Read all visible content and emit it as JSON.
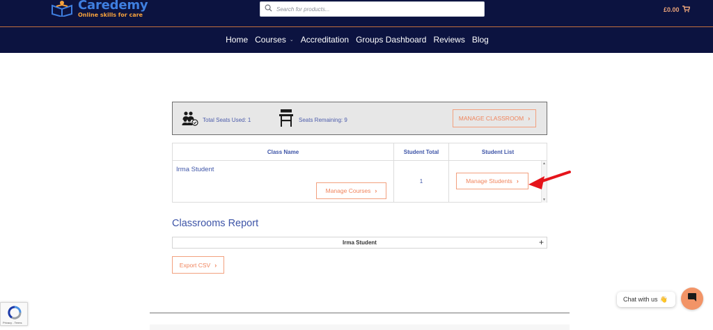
{
  "header": {
    "brand": "Caredemy",
    "tagline": "Online skills for care",
    "search_placeholder": "Search for products...",
    "cart_total": "£0.00"
  },
  "nav": {
    "items": [
      "Home",
      "Courses",
      "Accreditation",
      "Groups Dashboard",
      "Reviews",
      "Blog"
    ]
  },
  "seats": {
    "used_label": "Total Seats Used: 1",
    "remaining_label": "Seats Remaining: 9",
    "manage_classroom": "MANAGE CLASSROOM"
  },
  "class_table": {
    "headers": [
      "Class Name",
      "Student Total",
      "Student List"
    ],
    "rows": [
      {
        "class_name": "Irma Student",
        "student_total": "1",
        "manage_courses": "Manage Courses",
        "manage_students": "Manage Students"
      }
    ]
  },
  "report": {
    "title": "Classrooms Report",
    "accordion_label": "Irma Student",
    "export_label": "Export CSV"
  },
  "widgets": {
    "captcha_text": "Privacy - Terms",
    "chat_label": "Chat with us",
    "chat_emoji": "👋"
  },
  "colors": {
    "header_bg": "#0c1340",
    "accent": "#f0845c",
    "link_blue": "#3d54a7"
  }
}
